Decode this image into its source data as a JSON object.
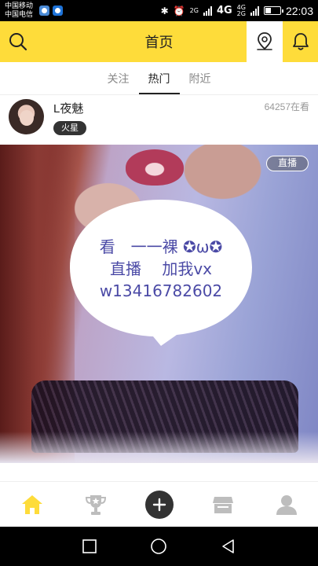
{
  "status_bar": {
    "carrier1": "中国移动",
    "carrier2": "中国电信",
    "net_top": "2G",
    "net_main": "4G",
    "net_sub_top": "4G",
    "net_sub_bottom": "2G",
    "time": "22:03"
  },
  "header": {
    "title": "首页",
    "accent_color": "#fedc3a"
  },
  "tabs": [
    {
      "label": "关注",
      "active": false
    },
    {
      "label": "热门",
      "active": true
    },
    {
      "label": "附近",
      "active": false
    }
  ],
  "streamer": {
    "name": "L夜魅",
    "badge": "火星",
    "viewers": "64257在看"
  },
  "stream": {
    "live_label": "直播",
    "bubble_line1": "看　一一裸 ✪ω✪",
    "bubble_line2": "直播　 加我vx",
    "bubble_line3": "w13416782602"
  },
  "bottom_nav": [
    {
      "icon": "home-icon",
      "active": true
    },
    {
      "icon": "trophy-icon",
      "active": false
    },
    {
      "icon": "plus-icon",
      "active": false
    },
    {
      "icon": "shop-icon",
      "active": false
    },
    {
      "icon": "profile-icon",
      "active": false
    }
  ]
}
